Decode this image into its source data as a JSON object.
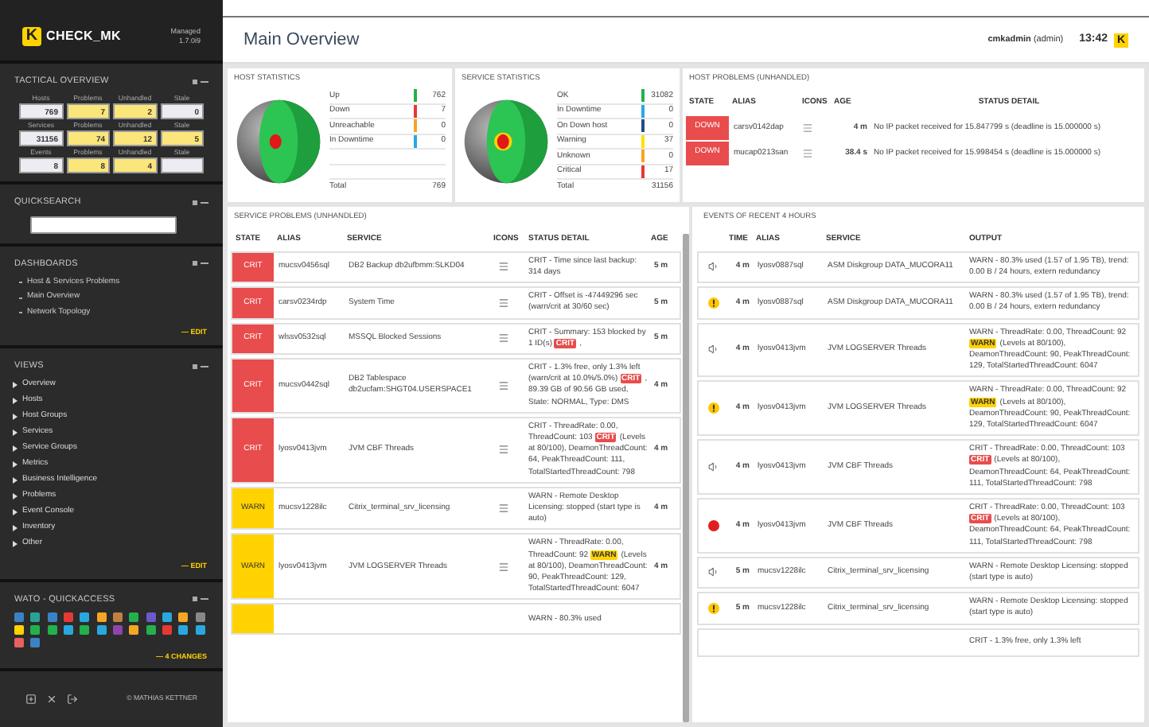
{
  "sidebar": {
    "brand": {
      "mark": "K",
      "name": "CHECK_MK",
      "edition": "Managed",
      "version": "1.7.0i9"
    },
    "tactical": {
      "title": "TACTICAL OVERVIEW",
      "rows": [
        {
          "cells": [
            {
              "label": "Hosts",
              "value": "769",
              "highlight": false
            },
            {
              "label": "Problems",
              "value": "7",
              "highlight": true
            },
            {
              "label": "Unhandled",
              "value": "2",
              "highlight": true
            },
            {
              "label": "Stale",
              "value": "0",
              "highlight": false
            }
          ]
        },
        {
          "cells": [
            {
              "label": "Services",
              "value": "31156",
              "highlight": false
            },
            {
              "label": "Problems",
              "value": "74",
              "highlight": true
            },
            {
              "label": "Unhandled",
              "value": "12",
              "highlight": true
            },
            {
              "label": "Stale",
              "value": "5",
              "highlight": true
            }
          ]
        },
        {
          "cells": [
            {
              "label": "Events",
              "value": "8",
              "highlight": false
            },
            {
              "label": "Problems",
              "value": "8",
              "highlight": true
            },
            {
              "label": "Unhandled",
              "value": "4",
              "highlight": true
            },
            {
              "label": "Stale",
              "highlight": false
            }
          ]
        }
      ]
    },
    "quicksearch": {
      "title": "QUICKSEARCH"
    },
    "dashboards": {
      "title": "DASHBOARDS",
      "items": [
        "Host & Services Problems",
        "Main Overview",
        "Network Topology"
      ],
      "edit": "— EDIT"
    },
    "views": {
      "title": "VIEWS",
      "items": [
        "Overview",
        "Hosts",
        "Host Groups",
        "Services",
        "Service Groups",
        "Metrics",
        "Business Intelligence",
        "Problems",
        "Event Console",
        "Inventory",
        "Other"
      ],
      "edit": "— EDIT"
    },
    "wato": {
      "title": "WATO - QUICKACCESS",
      "changes": "— 4 CHANGES"
    },
    "footer": {
      "copyright": "© MATHIAS KETTNER"
    }
  },
  "header": {
    "title": "Main Overview",
    "user": "cmkadmin",
    "role": "(admin)",
    "time": "13:42",
    "mark": "K"
  },
  "host_statistics": {
    "title": "HOST STATISTICS",
    "rows": [
      {
        "label": "Up",
        "color": "#22b14c",
        "value": "762"
      },
      {
        "label": "Down",
        "color": "#e53935",
        "value": "7"
      },
      {
        "label": "Unreachable",
        "color": "#f5a623",
        "value": "0"
      },
      {
        "label": "In Downtime",
        "color": "#29a8e0",
        "value": "0"
      }
    ],
    "total_label": "Total",
    "total": "769"
  },
  "service_statistics": {
    "title": "SERVICE STATISTICS",
    "rows": [
      {
        "label": "OK",
        "color": "#22b14c",
        "value": "31082"
      },
      {
        "label": "In Downtime",
        "color": "#29a8e0",
        "value": "0"
      },
      {
        "label": "On Down host",
        "color": "#1f4e8c",
        "value": "0"
      },
      {
        "label": "Warning",
        "color": "#ffe000",
        "value": "37"
      },
      {
        "label": "Unknown",
        "color": "#f5a623",
        "value": "0"
      },
      {
        "label": "Critical",
        "color": "#e53935",
        "value": "17"
      }
    ],
    "total_label": "Total",
    "total": "31156"
  },
  "host_problems": {
    "title": "HOST PROBLEMS (UNHANDLED)",
    "columns": [
      "STATE",
      "ALIAS",
      "ICONS",
      "AGE",
      "STATUS DETAIL"
    ],
    "rows": [
      {
        "kind": "down",
        "state": "DOWN",
        "alias": "carsv0142dap",
        "age": "4 m",
        "detail": "No IP packet received for 15.847799 s (deadline is 15.000000 s)"
      },
      {
        "kind": "down",
        "state": "DOWN",
        "alias": "mucap0213san",
        "age": "38.4 s",
        "detail": "No IP packet received for 15.998454 s (deadline is 15.000000 s)"
      }
    ]
  },
  "service_problems": {
    "title": "SERVICE PROBLEMS (UNHANDLED)",
    "columns": [
      "STATE",
      "ALIAS",
      "SERVICE",
      "ICONS",
      "STATUS DETAIL",
      "AGE"
    ],
    "rows": [
      {
        "kind": "crit",
        "state": "CRIT",
        "alias": "mucsv0456sql",
        "service": "DB2 Backup db2ufbmm:SLKD04",
        "detail": [
          {
            "kind": "text",
            "text": "CRIT - Time since last backup: 314 days"
          }
        ],
        "age": "5 m"
      },
      {
        "kind": "crit",
        "state": "CRIT",
        "alias": "carsv0234rdp",
        "service": "System Time",
        "detail": [
          {
            "kind": "text",
            "text": "CRIT - Offset is -47449296 sec (warn/crit at 30/60 sec)"
          }
        ],
        "age": "5 m"
      },
      {
        "kind": "crit",
        "state": "CRIT",
        "alias": "wlssv0532sql",
        "service": "MSSQL Blocked Sessions",
        "detail": [
          {
            "kind": "text",
            "text": "CRIT - Summary: 153 blocked by 1 ID(s)"
          },
          {
            "kind": "crit",
            "text": "CRIT"
          },
          {
            "kind": "text",
            "text": ","
          }
        ],
        "age": "5 m"
      },
      {
        "kind": "crit",
        "state": "CRIT",
        "alias": "mucsv0442sql",
        "service": "DB2 Tablespace db2ucfam:SHGT04.USERSPACE1",
        "detail": [
          {
            "kind": "text",
            "text": "CRIT - 1.3% free, only 1.3% left (warn/crit at 10.0%/5.0%)"
          },
          {
            "kind": "crit",
            "text": "CRIT"
          },
          {
            "kind": "text",
            "text": ", 89.39 GB of 90.56 GB used, State: NORMAL, Type: DMS"
          }
        ],
        "age": "4 m"
      },
      {
        "kind": "crit",
        "state": "CRIT",
        "alias": "lyosv0413jvm",
        "service": "JVM CBF Threads",
        "detail": [
          {
            "kind": "text",
            "text": "CRIT - ThreadRate: 0.00, ThreadCount: 103"
          },
          {
            "kind": "crit",
            "text": "CRIT"
          },
          {
            "kind": "text",
            "text": "(Levels at 80/100), DeamonThreadCount: 64, PeakThreadCount: 111, TotalStartedThreadCount: 798"
          }
        ],
        "age": "4 m"
      },
      {
        "kind": "warn",
        "state": "WARN",
        "alias": "mucsv1228ilc",
        "service": "Citrix_terminal_srv_licensing",
        "detail": [
          {
            "kind": "text",
            "text": "WARN - Remote Desktop Licensing: stopped (start type is auto)"
          }
        ],
        "age": "4 m"
      },
      {
        "kind": "warn",
        "state": "WARN",
        "alias": "lyosv0413jvm",
        "service": "JVM LOGSERVER Threads",
        "detail": [
          {
            "kind": "text",
            "text": "WARN - ThreadRate: 0.00, ThreadCount: 92"
          },
          {
            "kind": "warn",
            "text": "WARN"
          },
          {
            "kind": "text",
            "text": "(Levels at 80/100), DeamonThreadCount: 90, PeakThreadCount: 129, TotalStartedThreadCount: 6047"
          }
        ],
        "age": "4 m"
      },
      {
        "kind": "warn",
        "detail": [
          {
            "kind": "text",
            "text": "WARN - 80.3% used"
          }
        ]
      }
    ]
  },
  "events": {
    "title": "EVENTS OF RECENT 4 HOURS",
    "columns": [
      "TIME",
      "ALIAS",
      "SERVICE",
      "OUTPUT"
    ],
    "rows": [
      {
        "kind": "sound",
        "time": "4 m",
        "alias": "lyosv0887sql",
        "service": "ASM Diskgroup DATA_MUCORA11",
        "output": [
          {
            "kind": "text",
            "text": "WARN - 80.3% used (1.57 of 1.95 TB), trend: 0.00 B / 24 hours, extern redundancy"
          }
        ]
      },
      {
        "kind": "warn",
        "time": "4 m",
        "alias": "lyosv0887sql",
        "service": "ASM Diskgroup DATA_MUCORA11",
        "output": [
          {
            "kind": "text",
            "text": "WARN - 80.3% used (1.57 of 1.95 TB), trend: 0.00 B / 24 hours, extern redundancy"
          }
        ]
      },
      {
        "kind": "sound",
        "time": "4 m",
        "alias": "lyosv0413jvm",
        "service": "JVM LOGSERVER Threads",
        "output": [
          {
            "kind": "text",
            "text": "WARN - ThreadRate: 0.00, ThreadCount: 92"
          },
          {
            "kind": "warn",
            "text": "WARN"
          },
          {
            "kind": "text",
            "text": "(Levels at 80/100), DeamonThreadCount: 90, PeakThreadCount: 129, TotalStartedThreadCount: 6047"
          }
        ]
      },
      {
        "kind": "warn",
        "time": "4 m",
        "alias": "lyosv0413jvm",
        "service": "JVM LOGSERVER Threads",
        "output": [
          {
            "kind": "text",
            "text": "WARN - ThreadRate: 0.00, ThreadCount: 92"
          },
          {
            "kind": "warn",
            "text": "WARN"
          },
          {
            "kind": "text",
            "text": "(Levels at 80/100), DeamonThreadCount: 90, PeakThreadCount: 129, TotalStartedThreadCount: 6047"
          }
        ]
      },
      {
        "kind": "sound",
        "time": "4 m",
        "alias": "lyosv0413jvm",
        "service": "JVM CBF Threads",
        "output": [
          {
            "kind": "text",
            "text": "CRIT - ThreadRate: 0.00, ThreadCount: 103"
          },
          {
            "kind": "crit",
            "text": "CRIT"
          },
          {
            "kind": "text",
            "text": "(Levels at 80/100), DeamonThreadCount: 64, PeakThreadCount: 111, TotalStartedThreadCount: 798"
          }
        ]
      },
      {
        "kind": "crit",
        "time": "4 m",
        "alias": "lyosv0413jvm",
        "service": "JVM CBF Threads",
        "output": [
          {
            "kind": "text",
            "text": "CRIT - ThreadRate: 0.00, ThreadCount: 103"
          },
          {
            "kind": "crit",
            "text": "CRIT"
          },
          {
            "kind": "text",
            "text": "(Levels at 80/100), DeamonThreadCount: 64, PeakThreadCount: 111, TotalStartedThreadCount: 798"
          }
        ]
      },
      {
        "kind": "sound",
        "time": "5 m",
        "alias": "mucsv1228ilc",
        "service": "Citrix_terminal_srv_licensing",
        "output": [
          {
            "kind": "text",
            "text": "WARN - Remote Desktop Licensing: stopped (start type is auto)"
          }
        ]
      },
      {
        "kind": "warn",
        "time": "5 m",
        "alias": "mucsv1228ilc",
        "service": "Citrix_terminal_srv_licensing",
        "output": [
          {
            "kind": "text",
            "text": "WARN - Remote Desktop Licensing: stopped (start type is auto)"
          }
        ]
      },
      {
        "output": [
          {
            "kind": "text",
            "text": "CRIT - 1.3% free, only 1.3% left"
          }
        ]
      }
    ]
  }
}
